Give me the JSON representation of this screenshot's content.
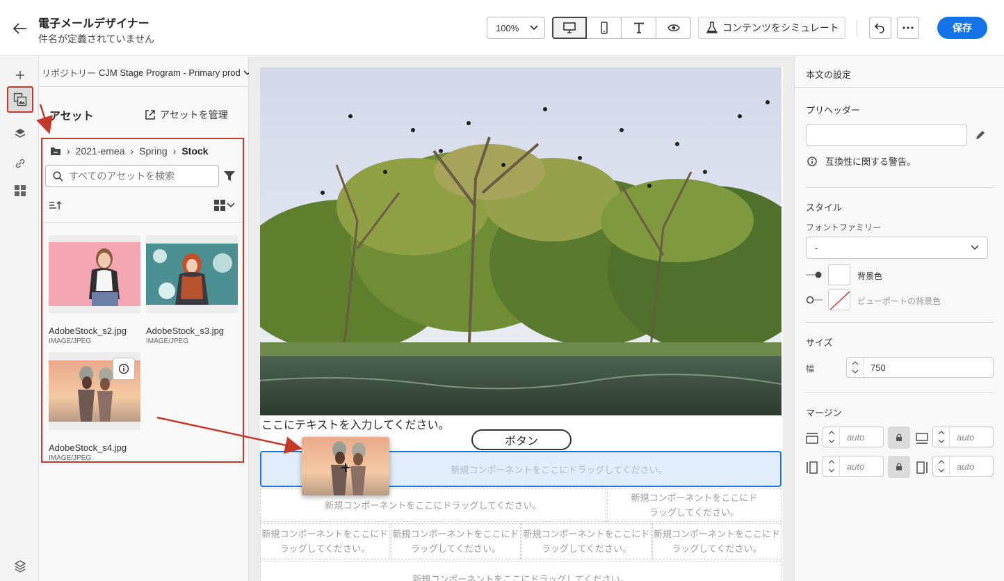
{
  "header": {
    "title": "電子メールデザイナー",
    "subtitle": "件名が定義されていません",
    "zoom": "100%",
    "simulate_label": "コンテンツをシミュレート",
    "save_label": "保存"
  },
  "assets_panel": {
    "repository_prefix": "リポジトリー",
    "repository_name": "CJM Stage Program - Primary prod",
    "title": "アセット",
    "manage_label": "アセットを管理",
    "breadcrumb": [
      "2021-emea",
      "Spring",
      "Stock"
    ],
    "search_placeholder": "すべてのアセットを検索",
    "assets": [
      {
        "name": "AdobeStock_s2.jpg",
        "type": "IMAGE/JPEG"
      },
      {
        "name": "AdobeStock_s3.jpg",
        "type": "IMAGE/JPEG"
      },
      {
        "name": "AdobeStock_s4.jpg",
        "type": "IMAGE/JPEG"
      }
    ]
  },
  "canvas": {
    "text_placeholder": "ここにテキストを入力してください。",
    "button_label": "ボタン",
    "drop_hint": "新規コンポーネントをここにドラッグしてください。",
    "drop_hint_line1": "新規コンポーネントをここにド",
    "drop_hint_line2": "ラッグしてください。"
  },
  "settings": {
    "header": "本文の設定",
    "preheader_label": "プリヘッダー",
    "compat_warning": "互換性に関する警告。",
    "style_label": "スタイル",
    "font_family_label": "フォントファミリー",
    "font_family_value": "-",
    "bg_color_label": "背景色",
    "viewport_bg_label": "ビューポートの背景色",
    "size_label": "サイズ",
    "width_label": "幅",
    "width_value": "750",
    "margin_label": "マージン",
    "margin_top": "auto",
    "margin_bottom": "auto",
    "margin_left": "auto",
    "margin_right": "auto"
  },
  "colors": {
    "accent": "#1473e6",
    "annotation": "#c0392b"
  }
}
